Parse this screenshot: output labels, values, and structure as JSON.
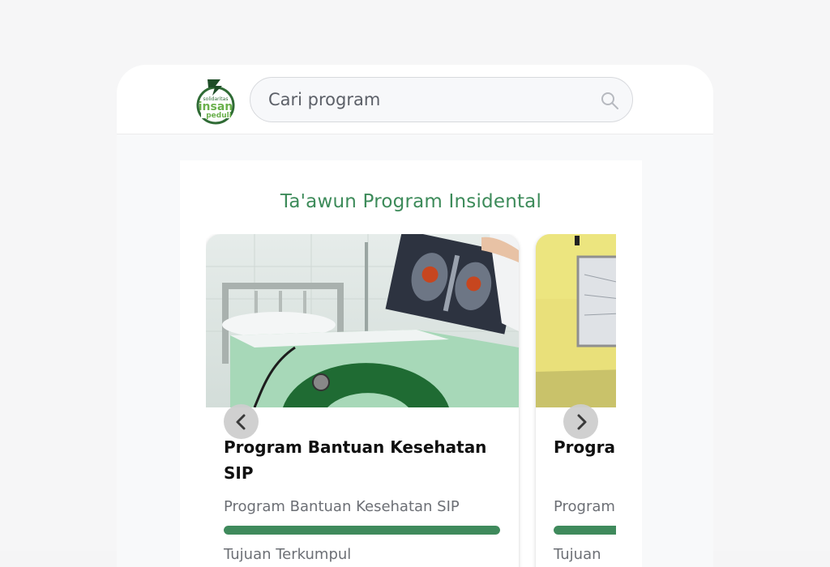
{
  "header": {
    "logo_alt": "solidaritas insan peduli",
    "search": {
      "placeholder": "Cari program"
    }
  },
  "section": {
    "title": "Ta'awun Program Insidental"
  },
  "carousel": {
    "prev_icon": "chevron-left-icon",
    "next_icon": "chevron-right-icon",
    "cards": [
      {
        "title": "Program Bantuan Kesehatan SIP",
        "description": "Program Bantuan Kesehatan SIP",
        "progress_percent": 100,
        "meta": "Tujuan Terkumpul"
      },
      {
        "title": "Program",
        "description": "Program",
        "progress_percent": 100,
        "meta": "Tujuan"
      }
    ]
  },
  "colors": {
    "accent": "#3d8b5a",
    "progress": "#3f8a5c",
    "header_bg": "#ffffff"
  }
}
